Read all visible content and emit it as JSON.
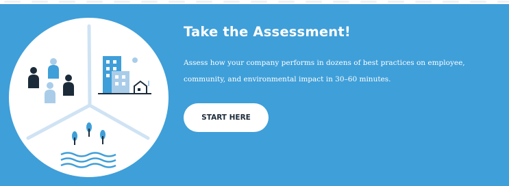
{
  "banner": {
    "title": "Take the Assessment!",
    "description": "Assess how your company performs in dozens of best practices on employee, community, and environmental impact in 30–60 minutes.",
    "cta_label": "START HERE",
    "background_color": "#3f9fd9",
    "text_color": "#ffffff",
    "button_color": "#ffffff",
    "button_text_color": "#1c2b3a"
  },
  "illustration": {
    "icons": [
      "people-icon",
      "buildings-icon",
      "house-icon",
      "trees-icon",
      "water-icon",
      "divider-lines"
    ],
    "dark_color": "#1c2b3a",
    "light_color": "#a9cde9"
  }
}
